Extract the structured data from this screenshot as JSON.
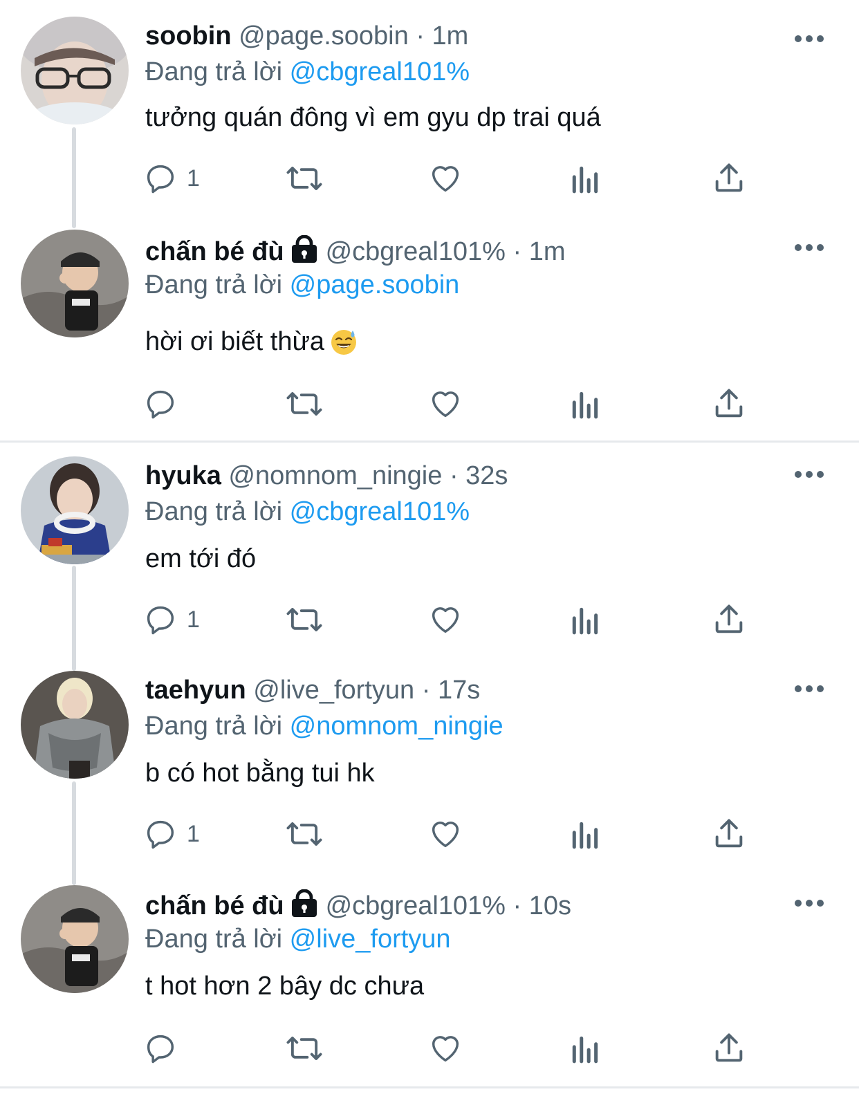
{
  "tweets": [
    {
      "display_name": "soobin",
      "handle": "@page.soobin",
      "separator": "·",
      "time": "1m",
      "reply_prefix": "Đang trả lời",
      "reply_to": "@cbgreal101%",
      "text": "tưởng quán đông vì em gyu dp trai quá",
      "reply_count": "1",
      "locked": false
    },
    {
      "display_name": "chấn bé đù",
      "handle": "@cbgreal101%",
      "separator": "·",
      "time": "1m",
      "reply_prefix": "Đang trả lời",
      "reply_to": "@page.soobin",
      "text": "hời ơi biết thừa",
      "emoji": "sweat-smile-emoji",
      "reply_count": "",
      "locked": true
    },
    {
      "display_name": "hyuka",
      "handle": "@nomnom_ningie",
      "separator": "·",
      "time": "32s",
      "reply_prefix": "Đang trả lời",
      "reply_to": "@cbgreal101%",
      "text": "em tới đó",
      "reply_count": "1",
      "locked": false
    },
    {
      "display_name": "taehyun",
      "handle": "@live_fortyun",
      "separator": "·",
      "time": "17s",
      "reply_prefix": "Đang trả lời",
      "reply_to": "@nomnom_ningie",
      "text": "b có hot bằng tui hk",
      "reply_count": "1",
      "locked": false
    },
    {
      "display_name": "chấn bé đù",
      "handle": "@cbgreal101%",
      "separator": "·",
      "time": "10s",
      "reply_prefix": "Đang trả lời",
      "reply_to": "@live_fortyun",
      "text": "t hot hơn 2 bây dc chưa",
      "reply_count": "",
      "locked": true
    }
  ],
  "colors": {
    "text": "#0f1419",
    "secondary": "#536471",
    "link": "#1d9bf0",
    "thread_line": "#d7dbdf",
    "divider": "#e6e9ec"
  },
  "icons": [
    "reply-icon",
    "retweet-icon",
    "like-icon",
    "views-icon",
    "share-icon",
    "more-icon",
    "lock-icon"
  ]
}
